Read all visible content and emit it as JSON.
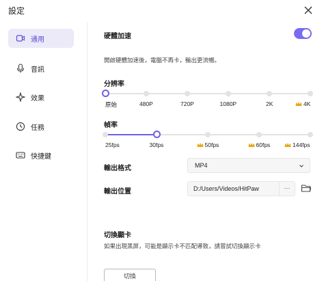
{
  "window": {
    "title": "設定"
  },
  "sidebar": {
    "items": [
      {
        "label": "通用",
        "icon": "general-icon",
        "active": true
      },
      {
        "label": "音訊",
        "icon": "microphone-icon",
        "active": false
      },
      {
        "label": "效果",
        "icon": "effects-sparkle-icon",
        "active": false
      },
      {
        "label": "任務",
        "icon": "clock-icon",
        "active": false
      },
      {
        "label": "快捷鍵",
        "icon": "keyboard-icon",
        "active": false
      }
    ]
  },
  "hardware_acceleration": {
    "label": "硬體加速",
    "enabled": true,
    "description": "開啟硬體加速後，電腦不再卡，輸出更流暢。"
  },
  "resolution": {
    "label": "分辨率",
    "options": [
      "原始",
      "480P",
      "720P",
      "1080P",
      "2K",
      "4K"
    ],
    "premium": [
      false,
      false,
      false,
      false,
      false,
      true
    ],
    "selected": "原始"
  },
  "frame_rate": {
    "label": "幀率",
    "options": [
      "25fps",
      "30fps",
      "50fps",
      "60fps",
      "144fps"
    ],
    "premium": [
      false,
      false,
      true,
      true,
      true
    ],
    "selected": "30fps"
  },
  "output_format": {
    "label": "輸出格式",
    "value": "MP4"
  },
  "output_location": {
    "label": "輸出位置",
    "path": "D:/Users/Videos/HitPaw",
    "more_label": "···"
  },
  "graphics_card": {
    "label": "切換顯卡",
    "description": "如果出現黑屏，可能是顯示卡不匹配導致，請嘗試切換顯示卡",
    "button_label": "切換"
  },
  "colors": {
    "accent": "#6e5fe8",
    "premium": "#e8a817"
  }
}
